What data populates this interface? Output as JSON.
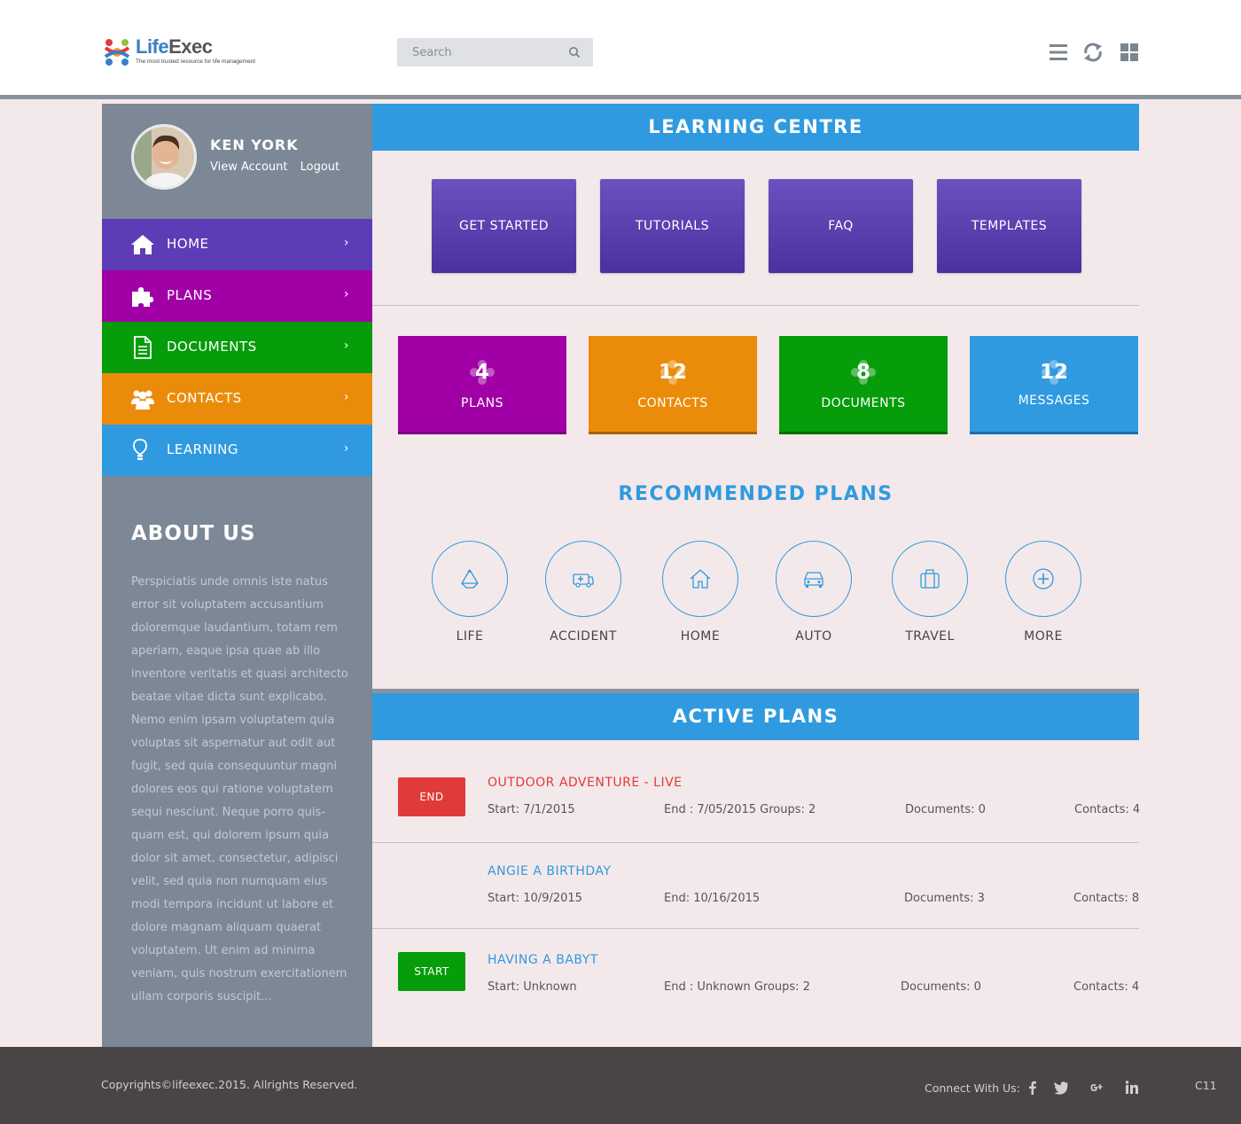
{
  "header": {
    "logo_life": "Life",
    "logo_exec": "Exec",
    "logo_tagline": "The most trusted resource for life management",
    "search_placeholder": "Search"
  },
  "sidebar": {
    "user_name": "KEN YORK",
    "view_account": "View Account",
    "logout": "Logout",
    "nav": [
      {
        "label": "HOME",
        "color": "#5e3cb7",
        "icon": "home-icon"
      },
      {
        "label": "PLANS",
        "color": "#a000a6",
        "icon": "puzzle-icon"
      },
      {
        "label": "DOCUMENTS",
        "color": "#069c0a",
        "icon": "document-icon"
      },
      {
        "label": "CONTACTS",
        "color": "#ea8c0a",
        "icon": "people-icon"
      },
      {
        "label": "LEARNING",
        "color": "#2f9ae0",
        "icon": "lightbulb-icon"
      }
    ],
    "about_title": "ABOUT US",
    "about_text": "Perspiciatis unde omnis iste natus error sit voluptatem accusantium doloremque laudantium, totam rem aperiam, eaque ipsa quae ab illo inventore veritatis et quasi architecto beatae vitae dicta sunt explicabo. Nemo enim ipsam voluptatem quia voluptas sit aspernatur aut odit aut fugit, sed quia consequuntur magni dolores eos qui ratione voluptatem sequi nesciunt. Neque porro quis-quam est, qui dolorem ipsum quia dolor sit amet, consectetur, adipisci velit, sed quia non numquam eius modi tempora incidunt ut labore et dolore magnam aliquam quaerat voluptatem. Ut enim ad minima veniam, quis nostrum exercitationem ullam corporis suscipit..."
  },
  "learning_centre": {
    "title": "LEARNING CENTRE",
    "buttons": [
      "GET STARTED",
      "TUTORIALS",
      "FAQ",
      "TEMPLATES"
    ]
  },
  "stats": [
    {
      "count": "4",
      "label": "PLANS",
      "color": "#a000a6",
      "border": "#7d0082"
    },
    {
      "count": "12",
      "label": "CONTACTS",
      "color": "#ea8c0a",
      "border": "#a8620a"
    },
    {
      "count": "8",
      "label": "DOCUMENTS",
      "color": "#069c0a",
      "border": "#056d08"
    },
    {
      "count": "12",
      "label": "MESSAGES",
      "color": "#2f9ae0",
      "border": "#1b6db0"
    }
  ],
  "recommended": {
    "title": "RECOMMENDED PLANS",
    "items": [
      {
        "label": "LIFE",
        "icon": "recycle-icon"
      },
      {
        "label": "ACCIDENT",
        "icon": "ambulance-icon"
      },
      {
        "label": "HOME",
        "icon": "house-icon"
      },
      {
        "label": "AUTO",
        "icon": "car-icon"
      },
      {
        "label": "TRAVEL",
        "icon": "suitcase-icon"
      },
      {
        "label": "MORE",
        "icon": "plus-circle-icon"
      }
    ]
  },
  "active_plans": {
    "title": "ACTIVE PLANS",
    "rows": [
      {
        "button": "END",
        "button_color": "#e03a3a",
        "title": "OUTDOOR ADVENTURE - LIVE",
        "title_color": "#e03a3a",
        "start": "Start: 7/1/2015",
        "end": "End : 7/05/2015 Groups: 2",
        "documents": "Documents: 0",
        "contacts": "Contacts: 4"
      },
      {
        "button": "",
        "button_color": "",
        "title": "ANGIE A BIRTHDAY",
        "title_color": "#2f9ae0",
        "start": "Start: 10/9/2015",
        "end": "End: 10/16/2015",
        "documents": "Documents: 3",
        "contacts": "Contacts: 8"
      },
      {
        "button": "START",
        "button_color": "#069c0a",
        "title": "HAVING A BABYT",
        "title_color": "#2f9ae0",
        "start": "Start: Unknown",
        "end": "End : Unknown Groups: 2",
        "documents": "Documents: 0",
        "contacts": "Contacts: 4"
      }
    ]
  },
  "footer": {
    "copyright": "Copyrights©lifeexec.2015. Allrights Reserved.",
    "connect": "Connect With Us:",
    "social": [
      "facebook-icon",
      "twitter-icon",
      "google-plus-icon",
      "linkedin-icon"
    ],
    "code": "C11"
  }
}
